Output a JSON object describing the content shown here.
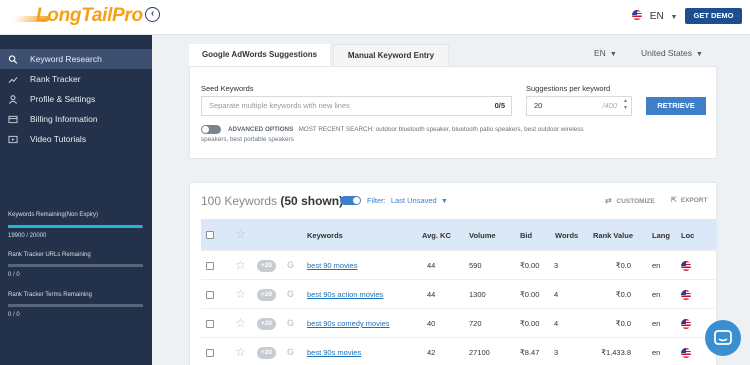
{
  "app": {
    "logo_text": "LongTailPro",
    "collapse_glyph": "‹"
  },
  "header": {
    "language": "EN",
    "get_demo": "GET DEMO",
    "flag": "us-flag-icon"
  },
  "sidebar": {
    "items": [
      {
        "label": "Keyword Research",
        "icon": "search-icon"
      },
      {
        "label": "Rank Tracker",
        "icon": "trend-icon"
      },
      {
        "label": "Profile & Settings",
        "icon": "user-icon"
      },
      {
        "label": "Billing Information",
        "icon": "card-icon"
      },
      {
        "label": "Video Tutorials",
        "icon": "play-icon"
      }
    ],
    "meters": [
      {
        "label": "Keywords Remaining(Non Expiry)",
        "value": "19900 / 20000",
        "fraction": 0.995
      },
      {
        "label": "Rank Tracker URLs Remaining",
        "value": "0 / 0",
        "fraction": 0
      },
      {
        "label": "Rank Tracker Terms Remaining",
        "value": "0 / 0",
        "fraction": 0
      }
    ]
  },
  "search": {
    "tabs": [
      "Google AdWords Suggestions",
      "Manual Keyword Entry"
    ],
    "language": "EN",
    "country": "United States",
    "seed_label": "Seed Keywords",
    "seed_placeholder": "Separate multiple keywords with new lines",
    "seed_count": "0/5",
    "suggest_label": "Suggestions per keyword",
    "suggest_value": "20",
    "suggest_max": "/400",
    "retrieve": "RETRIEVE",
    "advanced_options": "ADVANCED OPTIONS",
    "recent_search": "MOST RECENT SEARCH: outdoor bluetooth speaker, bluetooth patio speakers, best outdoor wireless speakers, best portable speakers"
  },
  "results": {
    "count_title": "100 Keywords",
    "shown": "(50 shown)",
    "filter_label": "Filter:",
    "filter_value": "Last Unsaved",
    "customize": "CUSTOMIZE",
    "export": "EXPORT",
    "columns": [
      "Keywords",
      "Avg. KC",
      "Volume",
      "Bid",
      "Words",
      "Rank Value",
      "Lang",
      "Loc"
    ],
    "rows": [
      {
        "badge": "+20",
        "keyword": "best 90 movies",
        "kc": "44",
        "volume": "590",
        "bid": "₹0.00",
        "words": "3",
        "rank_value": "₹0.0",
        "lang": "en"
      },
      {
        "badge": "+20",
        "keyword": "best 90s action movies",
        "kc": "44",
        "volume": "1300",
        "bid": "₹0.00",
        "words": "4",
        "rank_value": "₹0.0",
        "lang": "en"
      },
      {
        "badge": "+20",
        "keyword": "best 90s comedy movies",
        "kc": "40",
        "volume": "720",
        "bid": "₹0.00",
        "words": "4",
        "rank_value": "₹0.0",
        "lang": "en"
      },
      {
        "badge": "+20",
        "keyword": "best 90s movies",
        "kc": "42",
        "volume": "27100",
        "bid": "₹8.47",
        "words": "3",
        "rank_value": "₹1,433.8",
        "lang": "en"
      }
    ]
  },
  "colors": {
    "accent": "#3f7ec9",
    "sidebar": "#23324a",
    "logo": "#f4a018"
  }
}
